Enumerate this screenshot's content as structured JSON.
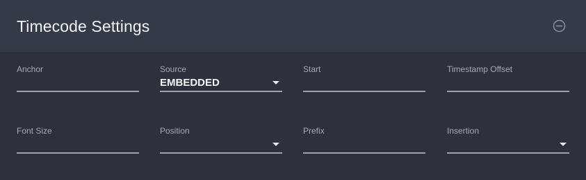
{
  "panel": {
    "title": "Timecode Settings",
    "collapse_icon": "minus-circle-icon"
  },
  "fields": {
    "anchor": {
      "label": "Anchor",
      "value": ""
    },
    "source": {
      "label": "Source",
      "value": "EMBEDDED"
    },
    "start": {
      "label": "Start",
      "value": ""
    },
    "timestamp_offset": {
      "label": "Timestamp Offset",
      "value": ""
    },
    "font_size": {
      "label": "Font Size",
      "value": ""
    },
    "position": {
      "label": "Position",
      "value": ""
    },
    "prefix": {
      "label": "Prefix",
      "value": ""
    },
    "insertion": {
      "label": "Insertion",
      "value": ""
    }
  },
  "colors": {
    "background": "#2d313c",
    "header": "#353a47",
    "underline": "#9ea3ad",
    "label": "#a7abb5"
  }
}
